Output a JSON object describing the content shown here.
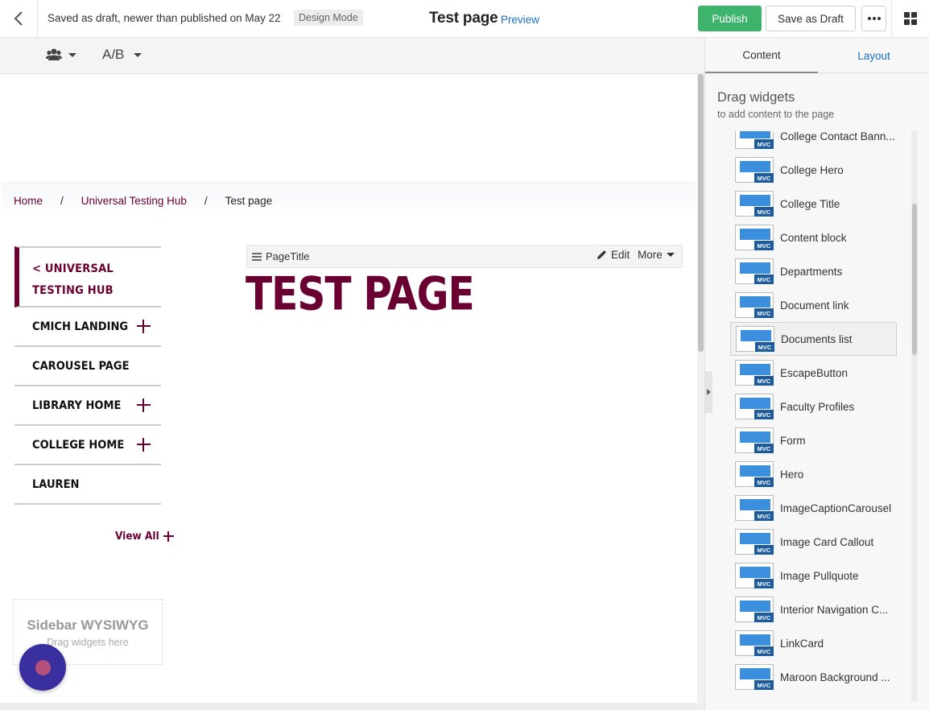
{
  "topbar": {
    "draft_status": "Saved as draft, newer than published on May 22",
    "mode_badge": "Design Mode",
    "page_title": "Test page",
    "preview_link": "Preview",
    "publish_label": "Publish",
    "save_draft_label": "Save as Draft",
    "back_icon": "chevron-left-icon",
    "more_icon": "ellipsis-icon",
    "apps_icon": "grid-icon"
  },
  "toolbar": {
    "persona_icon": "users-icon",
    "ab_label": "A/B"
  },
  "breadcrumb": {
    "home": "Home",
    "hub": "Universal Testing Hub",
    "separator": "/",
    "current": "Test page"
  },
  "sidenav": {
    "back_line1": "< UNIVERSAL",
    "back_line2": "TESTING HUB",
    "items": [
      {
        "label": "CMICH LANDING",
        "expandable": true
      },
      {
        "label": "CAROUSEL PAGE",
        "expandable": false
      },
      {
        "label": "LIBRARY HOME",
        "expandable": true
      },
      {
        "label": "COLLEGE HOME",
        "expandable": true
      },
      {
        "label": "LAUREN",
        "expandable": false
      }
    ],
    "view_all": "View All"
  },
  "sidebar_zone": {
    "title": "Sidebar WYSIWYG",
    "hint": "Drag widgets here"
  },
  "widget": {
    "name": "PageTitle",
    "edit_label": "Edit",
    "more_label": "More",
    "heading": "TEST PAGE"
  },
  "panel": {
    "tab_content": "Content",
    "tab_layout": "Layout",
    "title": "Drag widgets",
    "subtitle": "to add content to the page",
    "widgets": [
      "College Contact Bann...",
      "College Hero",
      "College Title",
      "Content block",
      "Departments",
      "Document link",
      "Documents list",
      "EscapeButton",
      "Faculty Profiles",
      "Form",
      "Hero",
      "ImageCaptionCarousel",
      "Image Card Callout",
      "Image Pullquote",
      "Interior Navigation C...",
      "LinkCard",
      "Maroon Background ..."
    ],
    "selected_widget": "Documents list",
    "mvc_badge": "MVC"
  },
  "colors": {
    "maroon": "#6a0032",
    "publish_green": "#3db36b",
    "link_blue": "#1a6fc7",
    "widget_blue": "#3c8fdc",
    "mvc_badge": "#1b5b9e",
    "chat_purple": "#3a2f9e"
  }
}
